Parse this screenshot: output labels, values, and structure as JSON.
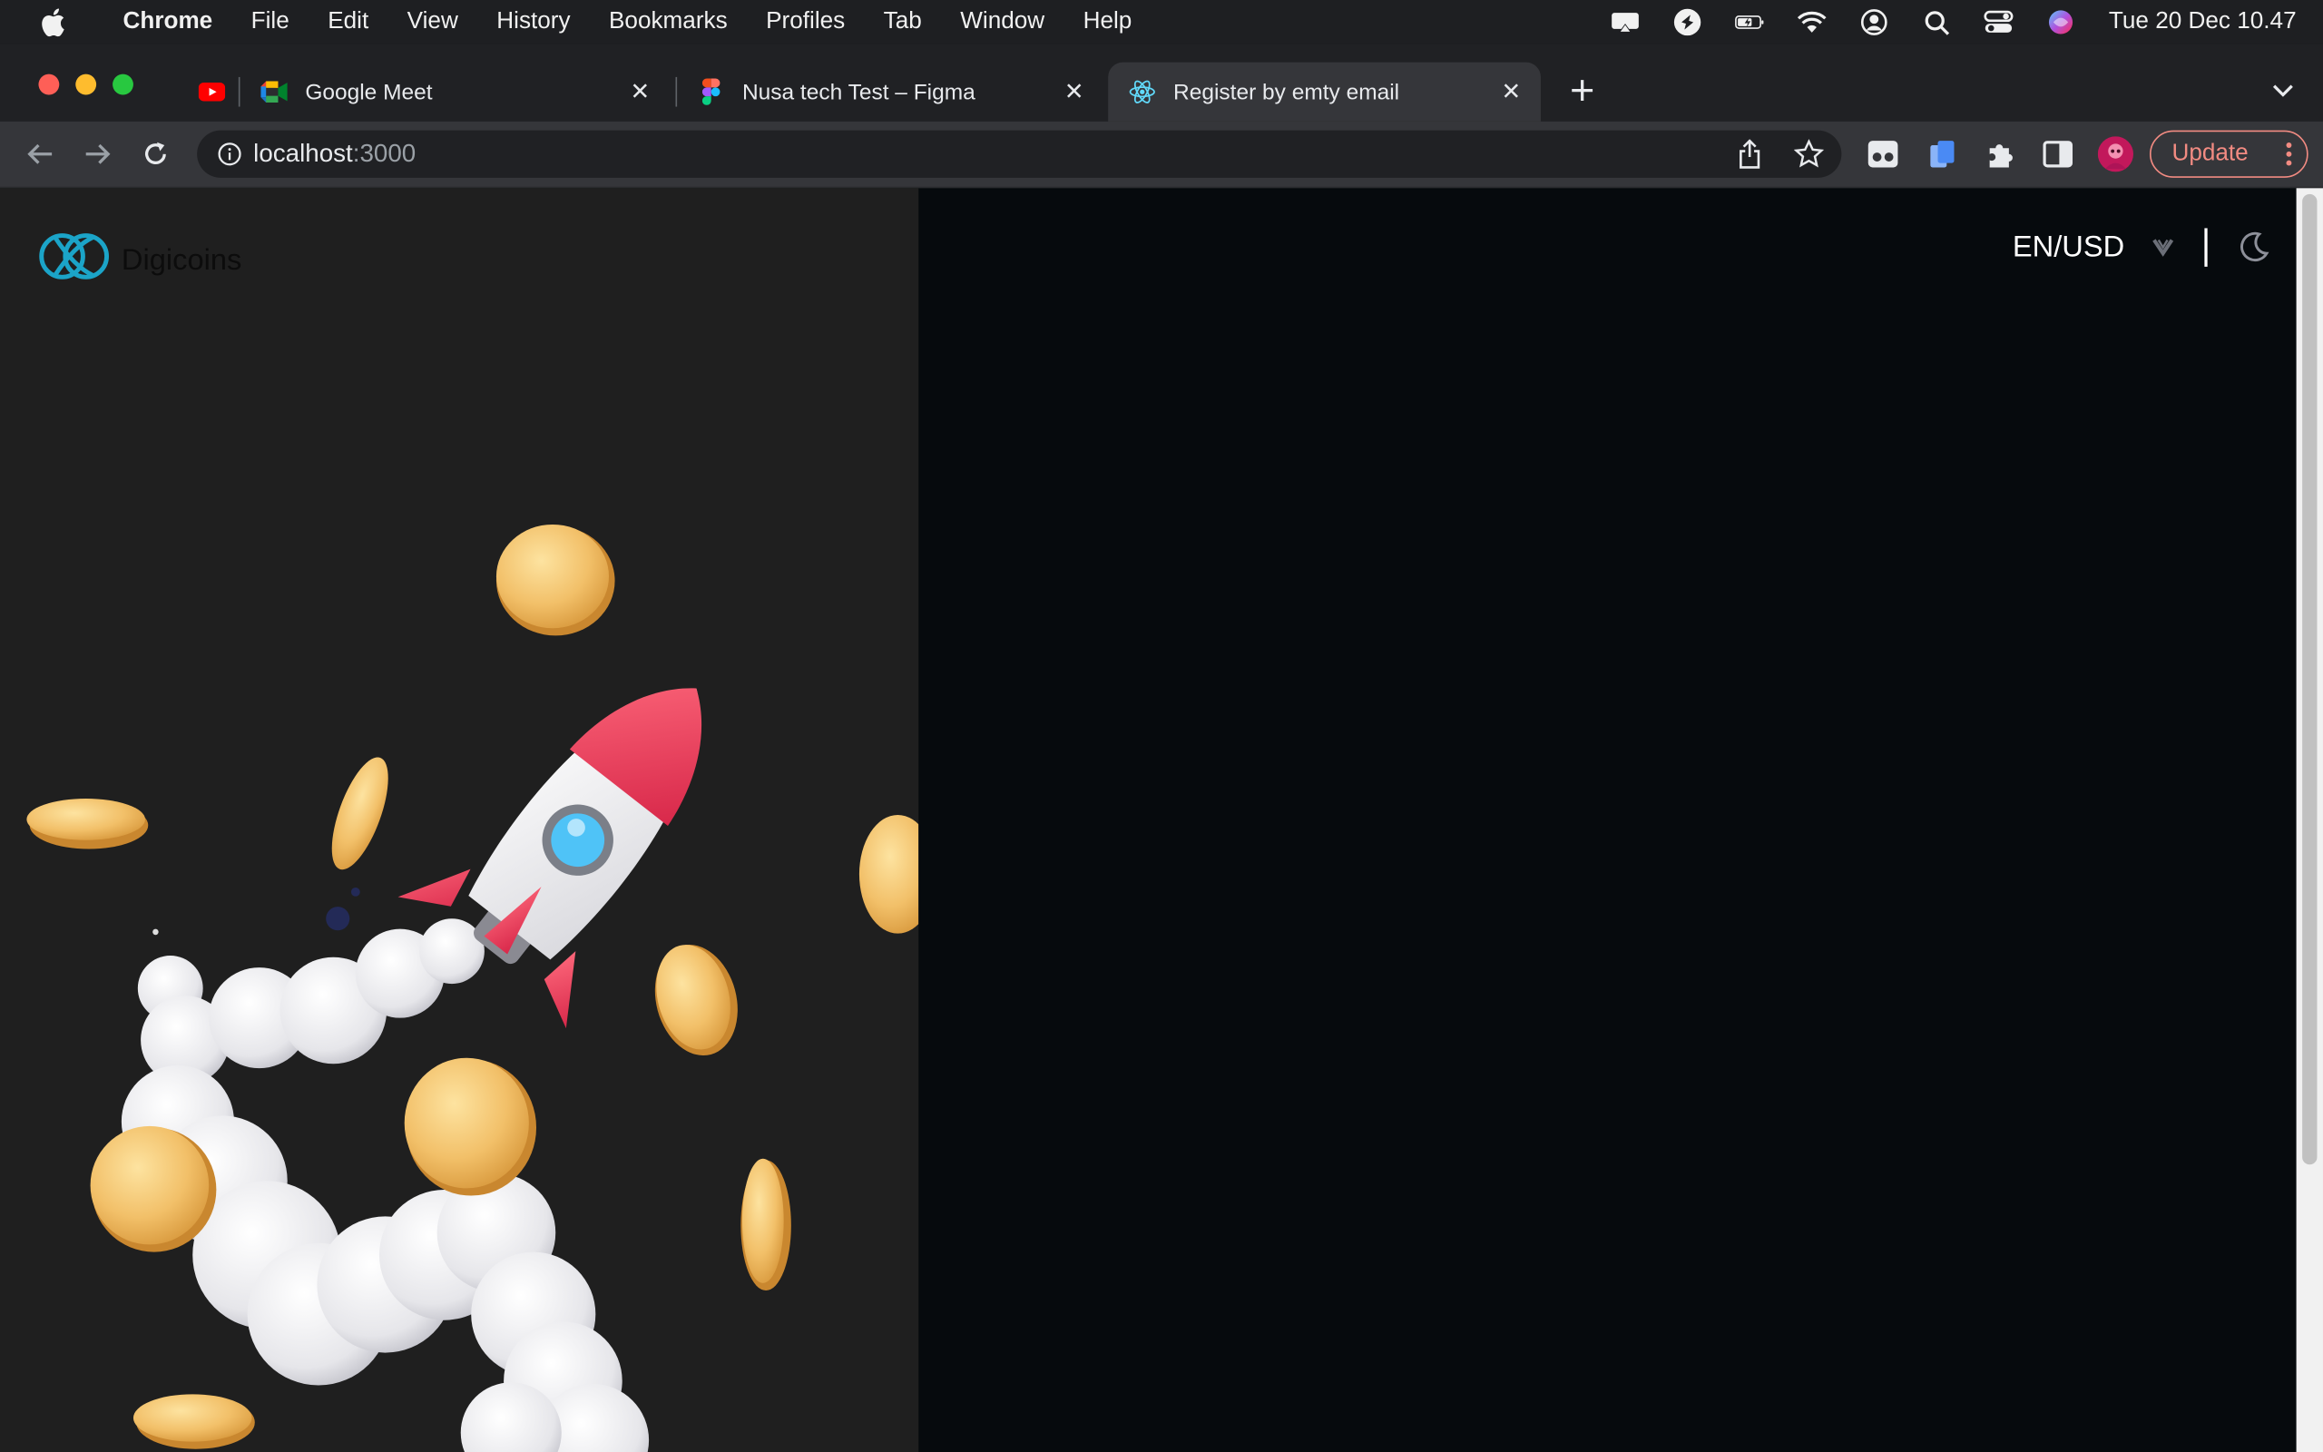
{
  "menubar": {
    "app": "Chrome",
    "items": [
      "File",
      "Edit",
      "View",
      "History",
      "Bookmarks",
      "Profiles",
      "Tab",
      "Window",
      "Help"
    ],
    "clock": "Tue 20 Dec  10.47"
  },
  "tabs": [
    {
      "label": "Google Meet",
      "icon": "google-meet-icon"
    },
    {
      "label": "Nusa tech Test – Figma",
      "icon": "figma-icon"
    },
    {
      "label": "Register by emty email",
      "icon": "react-icon"
    }
  ],
  "toolbar": {
    "url_host": "localhost",
    "url_port": ":3000",
    "update_label": "Update"
  },
  "page": {
    "brand": "Digicoins",
    "locale": "EN/USD"
  },
  "colors": {
    "accent": "#f28b82",
    "logo": "#1ba4c8",
    "left_panel": "#1f1f1f",
    "right_panel": "#060a0d"
  }
}
